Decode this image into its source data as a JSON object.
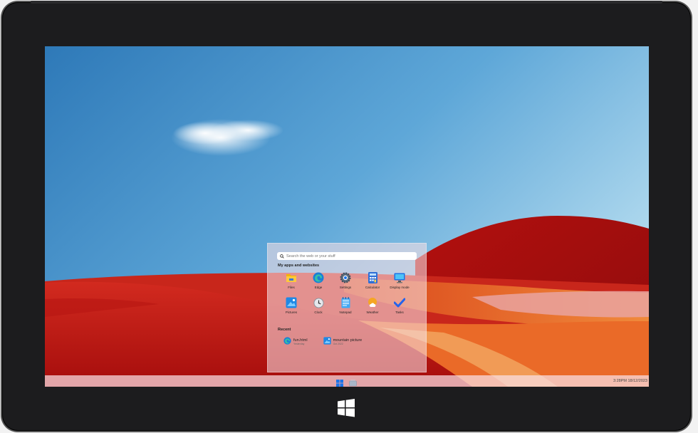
{
  "start_menu": {
    "search_placeholder": "Search the web or your stuff",
    "apps_heading": "My apps and websites",
    "apps": [
      {
        "label": "Files",
        "icon": "folder-icon"
      },
      {
        "label": "Edge",
        "icon": "edge-icon"
      },
      {
        "label": "Settings",
        "icon": "gear-icon"
      },
      {
        "label": "Calculator",
        "icon": "calculator-icon"
      },
      {
        "label": "Display mode",
        "icon": "monitor-icon"
      },
      {
        "label": "Pictures",
        "icon": "pictures-icon"
      },
      {
        "label": "Clock",
        "icon": "clock-icon"
      },
      {
        "label": "Notepad",
        "icon": "notepad-icon"
      },
      {
        "label": "Weather",
        "icon": "weather-icon"
      },
      {
        "label": "Tasks",
        "icon": "checkmark-icon"
      }
    ],
    "recent_heading": "Recent",
    "recent": [
      {
        "name": "fun.html",
        "time": "Yesterday",
        "icon": "edge-icon"
      },
      {
        "name": "mountain picture",
        "time": "Oct 2022",
        "icon": "pictures-icon"
      }
    ]
  },
  "taskbar": {
    "clock": "3:28PM 18/12/2023",
    "buttons": [
      {
        "name": "start",
        "icon": "windows-logo-icon"
      },
      {
        "name": "task-view",
        "icon": "task-view-icon"
      }
    ]
  },
  "colors": {
    "sky_top": "#3f8fca",
    "sky_bottom": "#a9d3ec",
    "hills_red": "#c4140f",
    "hills_orange": "#e8521b",
    "accent_blue": "#1a73e8"
  }
}
